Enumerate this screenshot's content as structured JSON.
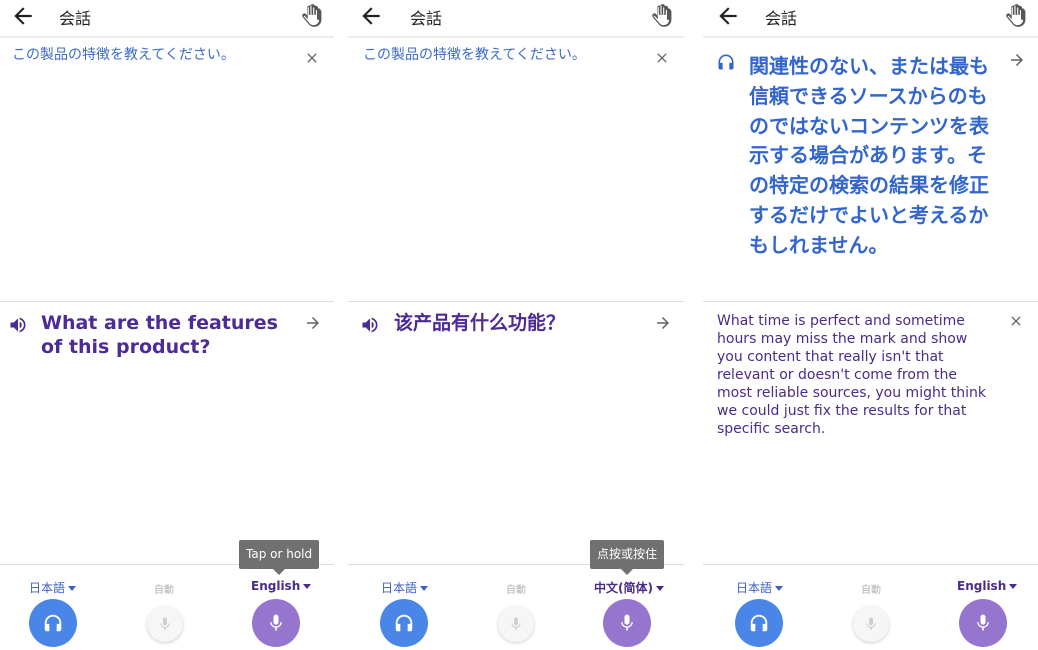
{
  "screens": [
    {
      "title": "会話",
      "upper_text": "この製品の特徴を教えてください。",
      "lower_text": "What are the features of this product?",
      "source_lang": "日本語",
      "auto_label": "自動",
      "target_lang": "English",
      "tooltip": "Tap or hold"
    },
    {
      "title": "会話",
      "upper_text": "この製品の特徴を教えてください。",
      "lower_text": "该产品有什么功能？",
      "source_lang": "日本語",
      "auto_label": "自動",
      "target_lang": "中文(简体)",
      "tooltip": "点按或按住"
    },
    {
      "title": "会話",
      "upper_text": "関連性のない、または最も信頼できるソースからのものではないコンテンツを表示する場合があります。その特定の検索の結果を修正するだけでよいと考えるかもしれません。",
      "lower_text": "What time is perfect and sometime hours may miss the mark and show you content that really isn't that relevant or doesn't come from the most reliable sources, you might think we could just fix the results for that specific search.",
      "source_lang": "日本語",
      "auto_label": "自動",
      "target_lang": "English"
    }
  ],
  "icons": {
    "back": "arrow-left-icon",
    "hand": "hand-icon",
    "close": "close-icon",
    "forward": "arrow-right-icon",
    "speaker": "speaker-icon",
    "headphones": "headphones-icon",
    "mic": "mic-icon"
  },
  "colors": {
    "blue_text": "#3b6bc9",
    "purple_text": "#4d2a96",
    "blue_button": "#4a86e8",
    "purple_button": "#9575cd",
    "tooltip_bg": "#707070"
  }
}
